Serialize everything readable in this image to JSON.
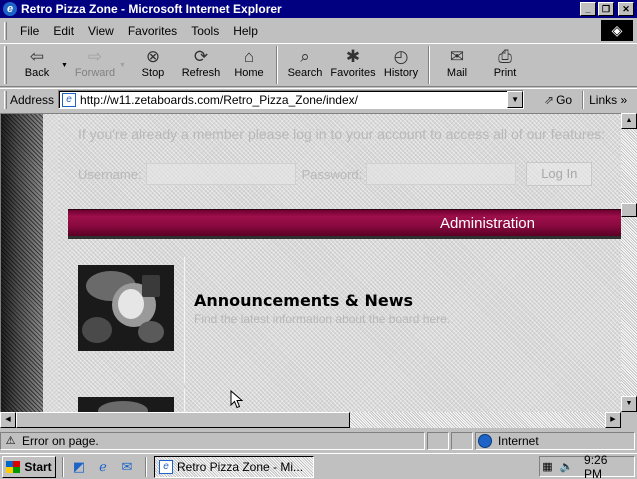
{
  "window": {
    "title": "Retro Pizza Zone - Microsoft Internet Explorer"
  },
  "menu": [
    "File",
    "Edit",
    "View",
    "Favorites",
    "Tools",
    "Help"
  ],
  "toolbar": {
    "back": "Back",
    "forward": "Forward",
    "stop": "Stop",
    "refresh": "Refresh",
    "home": "Home",
    "search": "Search",
    "favorites": "Favorites",
    "history": "History",
    "mail": "Mail",
    "print": "Print"
  },
  "address": {
    "label": "Address",
    "url": "http://w11.zetaboards.com/Retro_Pizza_Zone/index/",
    "go": "Go",
    "links": "Links"
  },
  "page": {
    "login_message": "If you're already a member please log in to your account to access all of our features:",
    "username_label": "Username:",
    "password_label": "Password:",
    "login_button": "Log In",
    "category_title": "Administration",
    "forums": [
      {
        "title": "Announcements & News",
        "description": "Find the latest information about the board here."
      }
    ]
  },
  "status": {
    "message": "Error on page.",
    "zone": "Internet"
  },
  "taskbar": {
    "start": "Start",
    "task": "Retro Pizza Zone - Mi...",
    "clock": "9:26 PM"
  },
  "colors": {
    "title_bar": "#000080",
    "category_bar": "#8a0a3f",
    "chrome": "#c0c0c0"
  }
}
